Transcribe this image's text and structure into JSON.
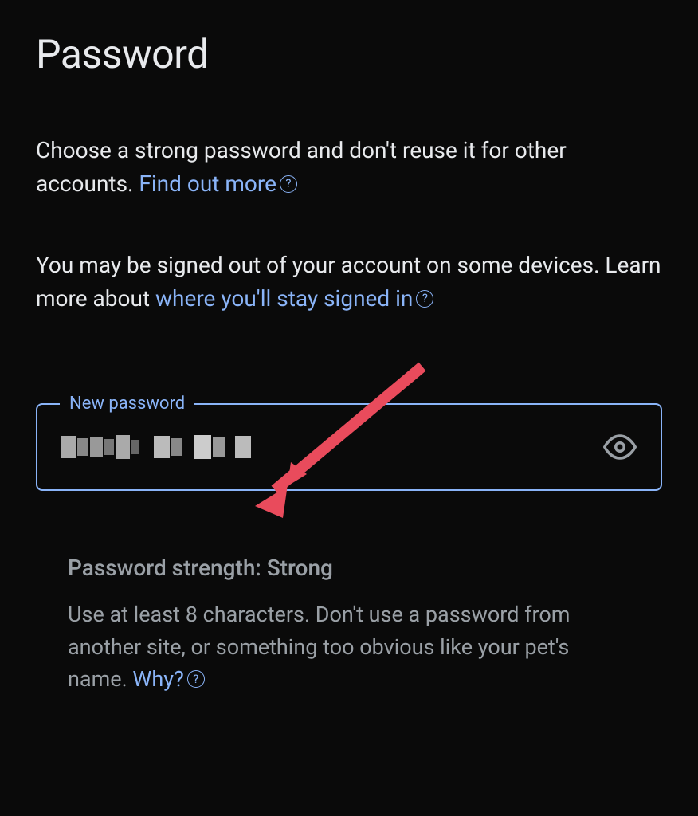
{
  "header": {
    "title": "Password"
  },
  "description": {
    "text_before_link": "Choose a strong password and don't reuse it for other accounts. ",
    "link_text": "Find out more"
  },
  "signout_notice": {
    "text_before_link": "You may be signed out of your account on some devices. Learn more about ",
    "link_text": "where you'll stay signed in"
  },
  "password_field": {
    "label": "New password",
    "value": "••••••••••"
  },
  "strength": {
    "label": "Password strength: Strong",
    "hint_before_link": "Use at least 8 characters. Don't use a password from another site, or something too obvious like your pet's name. ",
    "hint_link": "Why?"
  },
  "icons": {
    "help": "?",
    "eye": "eye-icon"
  }
}
